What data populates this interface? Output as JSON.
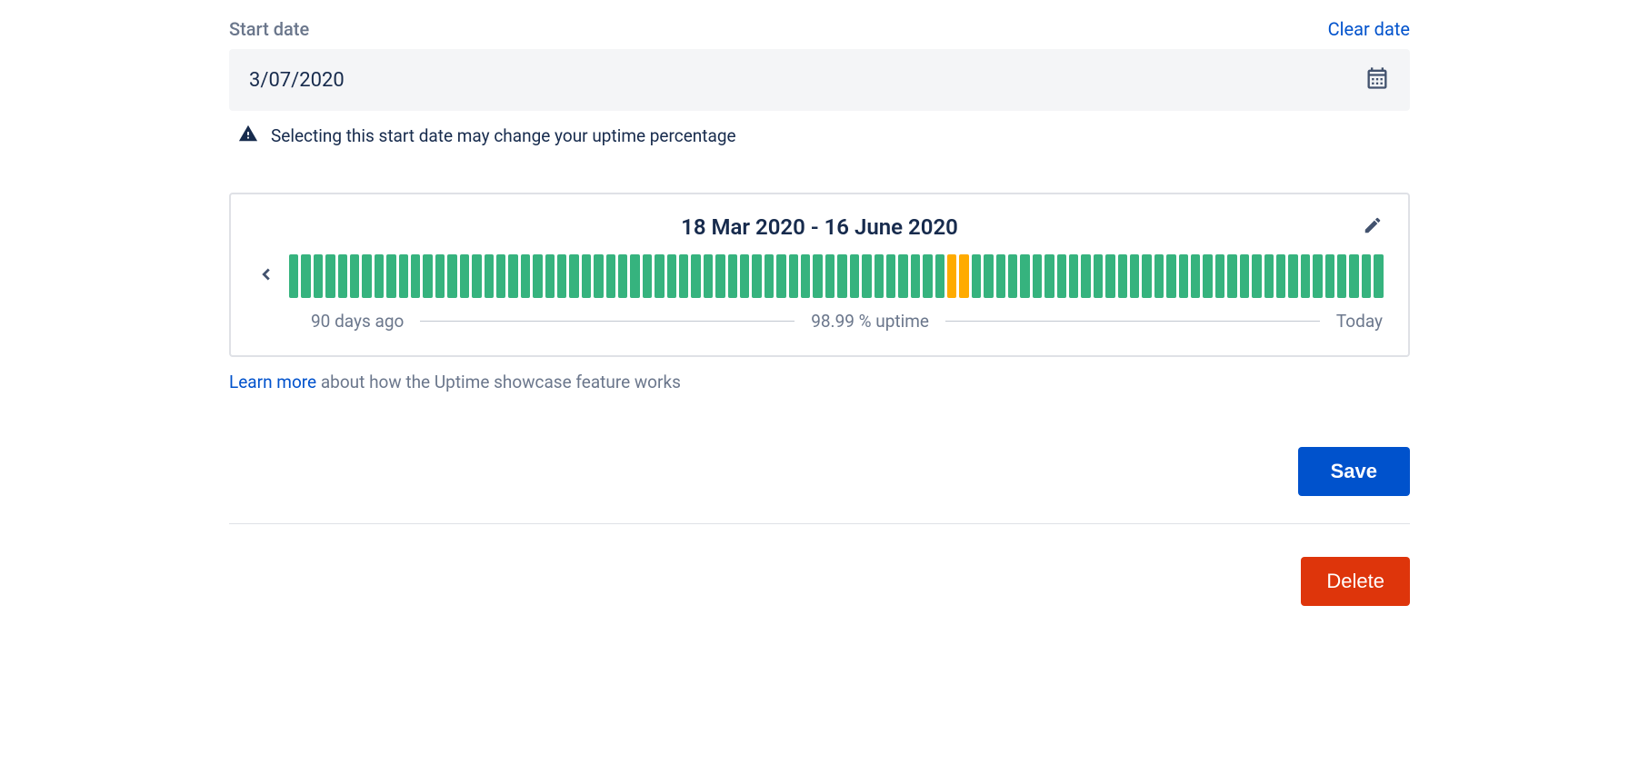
{
  "field": {
    "label": "Start date",
    "clear": "Clear date",
    "value": "3/07/2020"
  },
  "warning": {
    "text": "Selecting this start date may change your uptime percentage"
  },
  "uptime": {
    "range": "18 Mar 2020 - 16 June 2020",
    "left_label": "90 days ago",
    "center_label": "98.99 % uptime",
    "right_label": "Today",
    "bars": [
      "green",
      "green",
      "green",
      "green",
      "green",
      "green",
      "green",
      "green",
      "green",
      "green",
      "green",
      "green",
      "green",
      "green",
      "green",
      "green",
      "green",
      "green",
      "green",
      "green",
      "green",
      "green",
      "green",
      "green",
      "green",
      "green",
      "green",
      "green",
      "green",
      "green",
      "green",
      "green",
      "green",
      "green",
      "green",
      "green",
      "green",
      "green",
      "green",
      "green",
      "green",
      "green",
      "green",
      "green",
      "green",
      "green",
      "green",
      "green",
      "green",
      "green",
      "green",
      "green",
      "green",
      "green",
      "orange",
      "orange",
      "green",
      "green",
      "green",
      "green",
      "green",
      "green",
      "green",
      "green",
      "green",
      "green",
      "green",
      "green",
      "green",
      "green",
      "green",
      "green",
      "green",
      "green",
      "green",
      "green",
      "green",
      "green",
      "green",
      "green",
      "green",
      "green",
      "green",
      "green",
      "green",
      "green",
      "green",
      "green",
      "green",
      "green"
    ]
  },
  "learn": {
    "link": "Learn more",
    "rest": " about how the Uptime showcase feature works"
  },
  "buttons": {
    "save": "Save",
    "delete": "Delete"
  }
}
